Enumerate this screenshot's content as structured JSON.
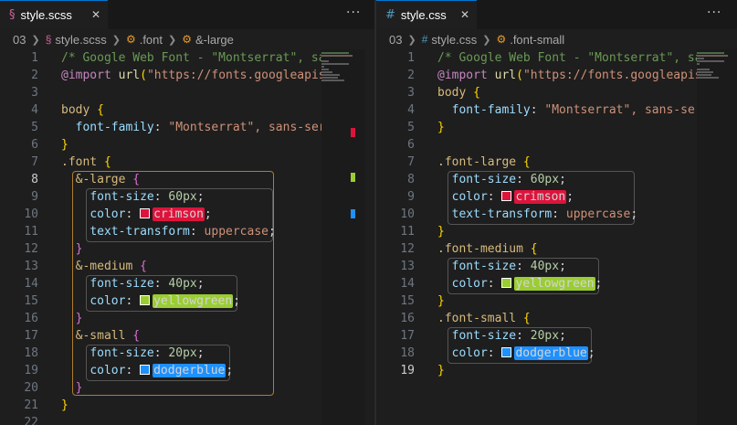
{
  "left": {
    "tab": {
      "icon": "sass-icon",
      "title": "style.scss",
      "close": "✕"
    },
    "more": "···",
    "breadcrumb": {
      "folder": "03",
      "file": "style.scss",
      "s1": ".font",
      "s2": "&-large"
    },
    "current_line": 8
  },
  "right": {
    "tab": {
      "icon": "css-icon",
      "title": "style.css",
      "close": "✕"
    },
    "more": "···",
    "breadcrumb": {
      "folder": "03",
      "file": "style.css",
      "s1": ".font-small"
    },
    "current_line": 19
  },
  "colors": {
    "crimson": "#dc143c",
    "yellowgreen": "#9acd32",
    "dodgerblue": "#1e90ff",
    "accent": "#0078d4"
  },
  "scss_lines": [
    "/* Google Web Font - \"Montserrat\", sa",
    "@import url(\"https://fonts.googleapis",
    "",
    "body {",
    "  font-family: \"Montserrat\", sans-ser",
    "}",
    ".font {",
    "  &-large {",
    "    font-size: 60px;",
    "    color: crimson;",
    "    text-transform: uppercase;",
    "  }",
    "  &-medium {",
    "    font-size: 40px;",
    "    color: yellowgreen;",
    "  }",
    "  &-small {",
    "    font-size: 20px;",
    "    color: dodgerblue;",
    "  }",
    "}",
    ""
  ],
  "css_lines": [
    "/* Google Web Font - \"Montserrat\", sa",
    "@import url(\"https://fonts.googleapis",
    "body {",
    "  font-family: \"Montserrat\", sans-ser",
    "}",
    "",
    ".font-large {",
    "  font-size: 60px;",
    "  color: crimson;",
    "  text-transform: uppercase;",
    "}",
    ".font-medium {",
    "  font-size: 40px;",
    "  color: yellowgreen;",
    "}",
    ".font-small {",
    "  font-size: 20px;",
    "  color: dodgerblue;",
    "}"
  ]
}
